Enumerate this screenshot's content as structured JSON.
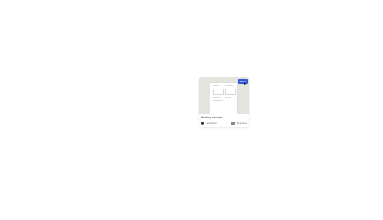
{
  "card": {
    "title": "Meeting minutes",
    "badge_label": "Word",
    "author": "Lashnibriel",
    "category_label": "Templates",
    "accent_color": "#2f5bd7",
    "thumb_bg_color": "#e4e4de"
  }
}
